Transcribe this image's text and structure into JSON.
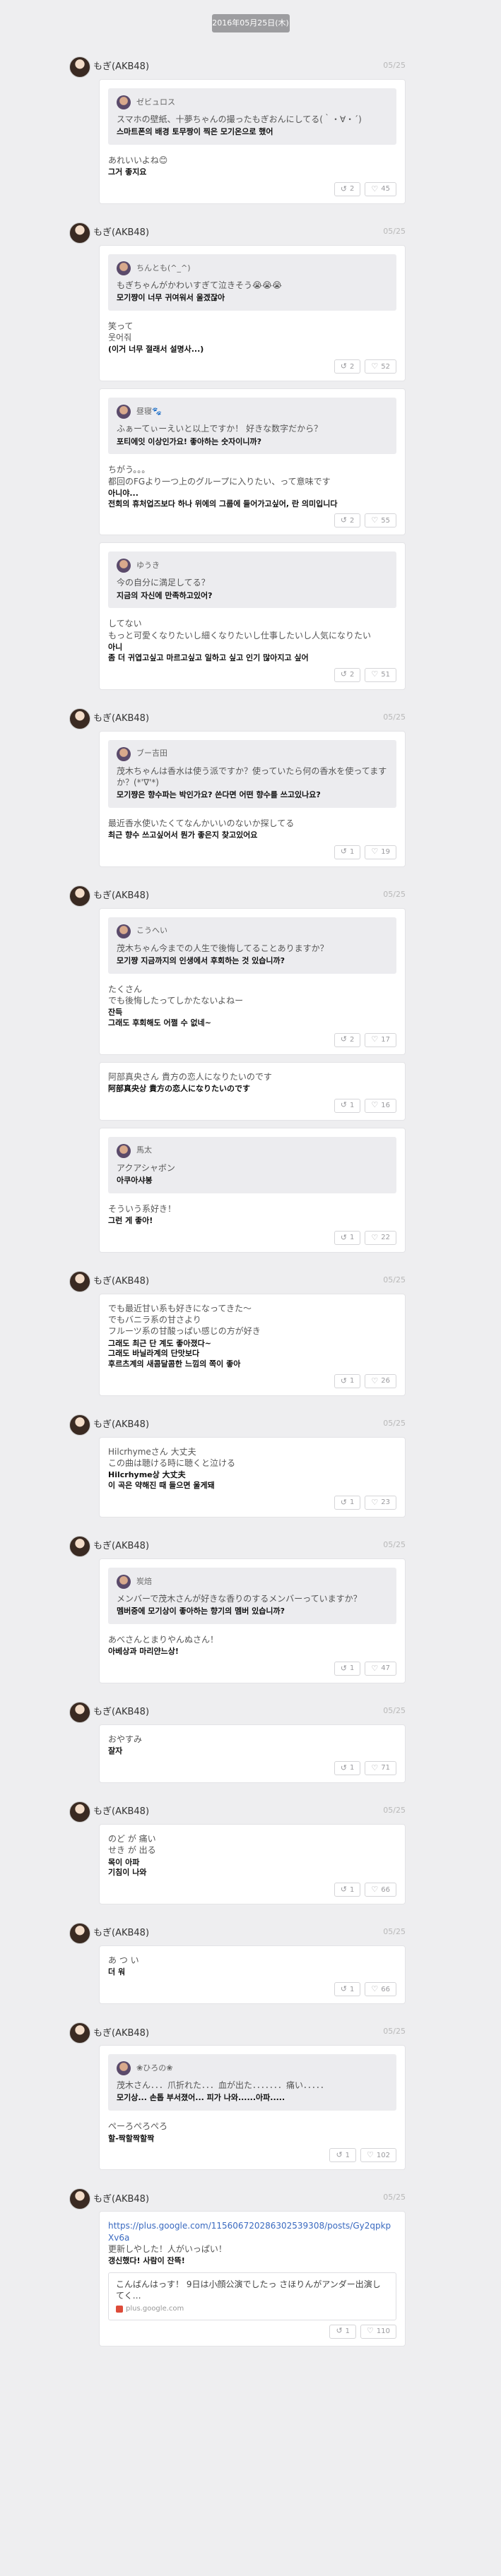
{
  "date": "2016年05月25日(木)",
  "colors": {
    "background": "#eeeef0",
    "card": "#ffffff",
    "quote": "#ececef",
    "link": "#3a6ac0"
  },
  "icons": {
    "reply": "reply-icon",
    "like": "like-icon"
  },
  "posts": [
    {
      "user": "もぎ(AKB48)",
      "date": "05/25",
      "cards": [
        {
          "quote": {
            "name": "ゼビュロス",
            "text": "スマホの壁紙、十夢ちゃんの撮ったもぎおんにしてる(｀・∀・´)",
            "tr": "스마트폰의 배경 토무짱이 찍은 모기온으로 했어"
          },
          "reply": "あれいいよね😊",
          "tr": "그거 좋지요",
          "stats": {
            "reply": "2",
            "like": "45"
          }
        }
      ]
    },
    {
      "user": "もぎ(AKB48)",
      "date": "05/25",
      "cards": [
        {
          "quote": {
            "name": "ちんとも(^_^)",
            "text": "もぎちゃんがかわいすぎて泣きそう😭😭😭",
            "tr": "모기쨩이 너무 귀여워서 울겠잖아"
          },
          "reply": "笑って\n웃어줘",
          "tr": "(이거 너무 절래서 설명사...)",
          "stats": {
            "reply": "2",
            "like": "52"
          }
        },
        {
          "quote": {
            "name": "昼寝🐾",
            "text": "ふぁーてぃーえいと以上ですか！ 好きな数字だから？",
            "tr": "포티에잇 이상인가요! 좋아하는 숫자이니까?"
          },
          "reply": "ちがう。。。\n都回のFGより一つ上のグループに入りたい、って意味です",
          "tr": "아니야...\n전회의 휴처업즈보다 하나 위에의 그룹에 들어가고싶어, 란 의미입니다",
          "stats": {
            "reply": "2",
            "like": "55"
          }
        },
        {
          "quote": {
            "name": "ゆうき",
            "text": "今の自分に満足してる？",
            "tr": "지금의 자신에 만족하고있어?"
          },
          "reply": "してない\nもっと可愛くなりたいし細くなりたいし仕事したいし人気になりたい",
          "tr": "아니\n좀 더 귀엽고싶고 마르고싶고 일하고 싶고 인기 많아지고 싶어",
          "stats": {
            "reply": "2",
            "like": "51"
          }
        }
      ]
    },
    {
      "user": "もぎ(AKB48)",
      "date": "05/25",
      "cards": [
        {
          "quote": {
            "name": "ブー吉田",
            "text": "茂木ちゃんは香水は使う派ですか？使っていたら何の香水を使ってますか？(*'∇'*)",
            "tr": "모기쨩은 향수파는 박인가요? 쓴다면 어떤 향수를 쓰고있나요?"
          },
          "reply": "最近香水使いたくてなんかいいのないか探してる",
          "tr": "최근 향수 쓰고싶어서 뭔가 좋은지 찾고있어요",
          "stats": {
            "reply": "1",
            "like": "19"
          }
        }
      ]
    },
    {
      "user": "もぎ(AKB48)",
      "date": "05/25",
      "cards": [
        {
          "quote": {
            "name": "こうへい",
            "text": "茂木ちゃん今までの人生で後悔してることありますか？",
            "tr": "모기쨩 지금까지의 인생에서 후회하는 것 있습니까?"
          },
          "reply": "たくさん\nでも後悔したってしかたないよねー",
          "tr": "잔득\n그래도 후회해도 어쩔 수 없네~",
          "stats": {
            "reply": "2",
            "like": "17"
          }
        },
        {
          "quote": null,
          "reply": "阿部真央さん 貴方の恋人になりたいのです",
          "tr": "阿部真央상 貴方の恋人になりたいのです",
          "stats": {
            "reply": "1",
            "like": "16"
          }
        },
        {
          "quote": {
            "name": "馬太",
            "text": "アクアシャボン",
            "tr": "아쿠아샤봉"
          },
          "reply": "そういう系好き！",
          "tr": "그런 게 좋아!",
          "stats": {
            "reply": "1",
            "like": "22"
          }
        }
      ]
    },
    {
      "user": "もぎ(AKB48)",
      "date": "05/25",
      "cards": [
        {
          "quote": null,
          "reply": "でも最近甘い系も好きになってきた〜\nでもバニラ系の甘さより\nフルーツ系の甘酸っぱい感じの方が好き",
          "tr": "그래도 최근 단 계도 좋아졌다~\n그래도 바닐라계의 단맛보다\n후르츠계의 새콤달콤한 느낌의 쪽이 좋아",
          "stats": {
            "reply": "1",
            "like": "26"
          }
        }
      ]
    },
    {
      "user": "もぎ(AKB48)",
      "date": "05/25",
      "cards": [
        {
          "quote": null,
          "reply": "Hilcrhymeさん 大丈夫\nこの曲は聴ける時に聴くと泣ける",
          "tr": "Hilcrhyme상 大丈夫\n이 곡은 약해진 때 들으면 울게돼",
          "stats": {
            "reply": "1",
            "like": "23"
          }
        }
      ]
    },
    {
      "user": "もぎ(AKB48)",
      "date": "05/25",
      "cards": [
        {
          "quote": {
            "name": "炭焙",
            "text": "メンバーで茂木さんが好きな香りのするメンバーっていますか？",
            "tr": "멤버중에 모기상이 좋아하는 향기의 멤버 있습니까?"
          },
          "reply": "あべさんとまりやんぬさん！",
          "tr": "아베상과 마리얀느상!",
          "stats": {
            "reply": "1",
            "like": "47"
          }
        }
      ]
    },
    {
      "user": "もぎ(AKB48)",
      "date": "05/25",
      "cards": [
        {
          "quote": null,
          "reply": "おやすみ",
          "tr": "잘자",
          "stats": {
            "reply": "1",
            "like": "71"
          }
        }
      ]
    },
    {
      "user": "もぎ(AKB48)",
      "date": "05/25",
      "cards": [
        {
          "quote": null,
          "reply": "のど が 痛い\nせき が 出る",
          "tr": "목이 아파\n기침이 나와",
          "stats": {
            "reply": "1",
            "like": "66"
          }
        }
      ]
    },
    {
      "user": "もぎ(AKB48)",
      "date": "05/25",
      "cards": [
        {
          "quote": null,
          "reply": "あ つ い",
          "tr": "더 워",
          "stats": {
            "reply": "1",
            "like": "66"
          }
        }
      ]
    },
    {
      "user": "もぎ(AKB48)",
      "date": "05/25",
      "cards": [
        {
          "quote": {
            "name": "❀ひろの❀",
            "text": "茂木さん．．．爪折れた．．．血が出た．．．．．．．痛い．．．．．",
            "tr": "모기상... 손톱 부서졌어... 피가 나와......아파....."
          },
          "reply": "ぺーろぺろぺろ",
          "tr": "할-짝할짝할짝",
          "stats": {
            "reply": "1",
            "like": "102"
          }
        }
      ]
    },
    {
      "user": "もぎ(AKB48)",
      "date": "05/25",
      "cards": [
        {
          "quote": null,
          "link": "https://plus.google.com/115606720286302539308/posts/Gy2qpkpXv6a",
          "reply": "更新しやした！人がいっぱい！",
          "tr": "갱신했다! 사람이 잔뜩!",
          "preview": {
            "text": "こんばんはっす！ 9日は小顔公演でしたっ さほりんがアンダー出演してく…",
            "domain": "plus.google.com"
          },
          "stats": {
            "reply": "1",
            "like": "110"
          }
        }
      ]
    }
  ]
}
